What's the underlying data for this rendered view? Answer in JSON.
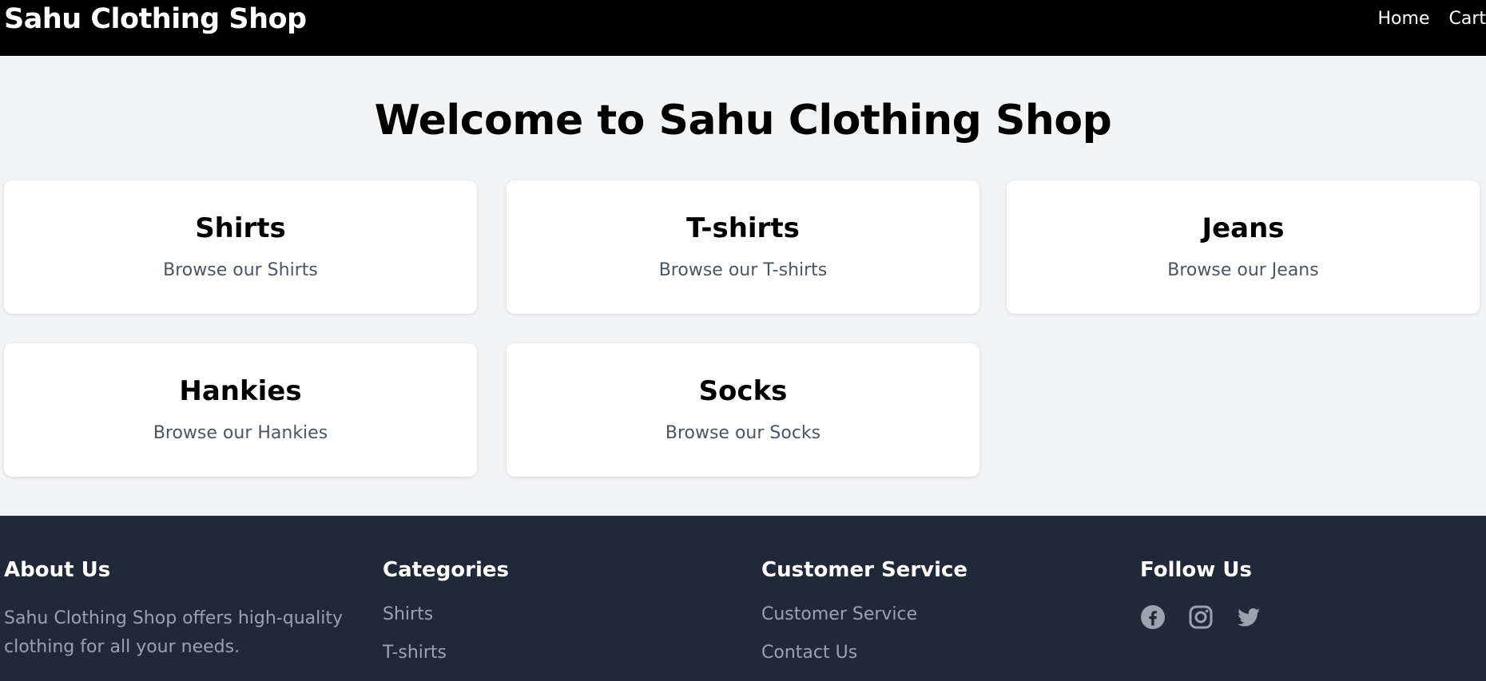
{
  "header": {
    "brand": "Sahu Clothing Shop",
    "nav": [
      {
        "label": "Home"
      },
      {
        "label": "Cart"
      }
    ]
  },
  "main": {
    "title": "Welcome to Sahu Clothing Shop",
    "categories": [
      {
        "title": "Shirts",
        "description": "Browse our Shirts"
      },
      {
        "title": "T-shirts",
        "description": "Browse our T-shirts"
      },
      {
        "title": "Jeans",
        "description": "Browse our Jeans"
      },
      {
        "title": "Hankies",
        "description": "Browse our Hankies"
      },
      {
        "title": "Socks",
        "description": "Browse our Socks"
      }
    ]
  },
  "footer": {
    "about": {
      "heading": "About Us",
      "text": "Sahu Clothing Shop offers high-quality clothing for all your needs."
    },
    "categories": {
      "heading": "Categories",
      "items": [
        "Shirts",
        "T-shirts"
      ]
    },
    "service": {
      "heading": "Customer Service",
      "items": [
        "Customer Service",
        "Contact Us"
      ]
    },
    "follow": {
      "heading": "Follow Us",
      "icons": [
        "facebook-icon",
        "instagram-icon",
        "twitter-icon"
      ]
    }
  },
  "colors": {
    "header_bg": "#000000",
    "page_bg": "#f3f4f6",
    "card_bg": "#ffffff",
    "footer_bg": "#1f2937",
    "muted_text": "#9ca3af",
    "card_desc": "#4b5563"
  }
}
